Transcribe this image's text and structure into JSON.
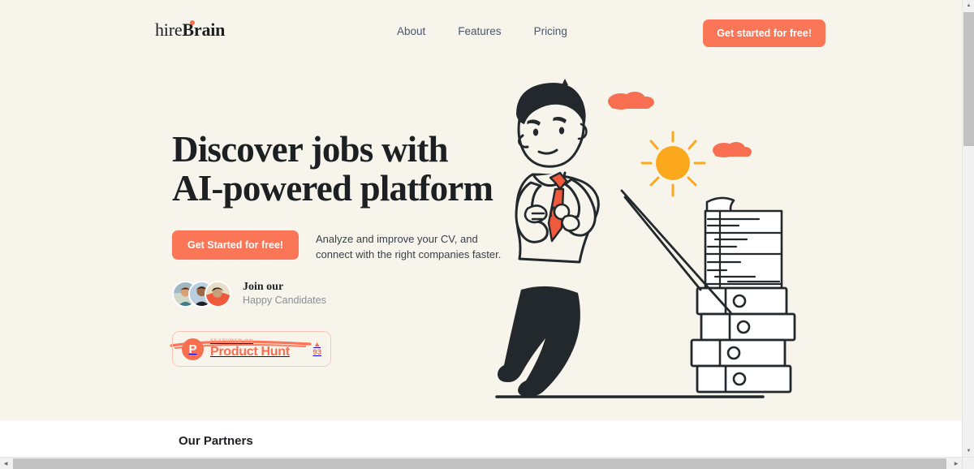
{
  "colors": {
    "hero_background": "#F7F4EC",
    "accent_orange": "#FB7557",
    "accent_coral": "#F86E51",
    "sun_yellow": "#FBA81C",
    "ink": "#22282B",
    "nav_link": "#4a5568",
    "muted_text": "#8a8f96",
    "page_white": "#ffffff"
  },
  "navbar": {
    "logo": {
      "part_light": "hire",
      "part_bold": "Brain",
      "dot_icon": "logo-dot-icon"
    },
    "links": [
      {
        "label": "About"
      },
      {
        "label": "Features"
      },
      {
        "label": "Pricing"
      }
    ],
    "cta_label": "Get started for free!"
  },
  "hero": {
    "headline_line1": "Discover jobs with",
    "headline_line2": "AI-powered platform",
    "underline_decoration": "hand-drawn-underline",
    "cta_label": "Get Started for free!",
    "subtext_line1": "Analyze and improve your CV, and",
    "subtext_line2": "connect with the right companies faster.",
    "social_proof": {
      "title": "Join our",
      "subtitle": "Happy Candidates",
      "avatar_count": 3,
      "avatars": [
        {
          "name": "avatar-candidate-1",
          "shirt": "#3f7d8c",
          "skin": "#d9a074",
          "bg": "#cfd9c9"
        },
        {
          "name": "avatar-candidate-2",
          "shirt": "#1d2023",
          "skin": "#9c6b45",
          "bg": "#b9cfe0"
        },
        {
          "name": "avatar-candidate-3",
          "shirt": "#F05A3C",
          "skin": "#caa07c",
          "bg": "#e8dfc9"
        }
      ]
    },
    "product_hunt": {
      "logo_letter": "P",
      "featured_label": "FEATURED ON",
      "name": "Product Hunt",
      "upvote_icon": "▲",
      "upvote_count": "93"
    },
    "illustration": {
      "name": "man-pulling-paperwork-illustration",
      "elements": [
        "businessman",
        "necktie",
        "wristwatch",
        "rope",
        "paper-stack",
        "archive-boxes",
        "sun",
        "clouds"
      ],
      "cloud_count": 2,
      "box_count": 4
    }
  },
  "partners": {
    "title": "Our Partners"
  },
  "browser_chrome": {
    "vertical_scrollbar": {
      "name": "vertical-scrollbar",
      "up_arrow": "▲",
      "down_arrow": "▼"
    },
    "horizontal_scrollbar": {
      "name": "horizontal-scrollbar",
      "left_arrow": "◀",
      "right_arrow": "▶"
    }
  }
}
